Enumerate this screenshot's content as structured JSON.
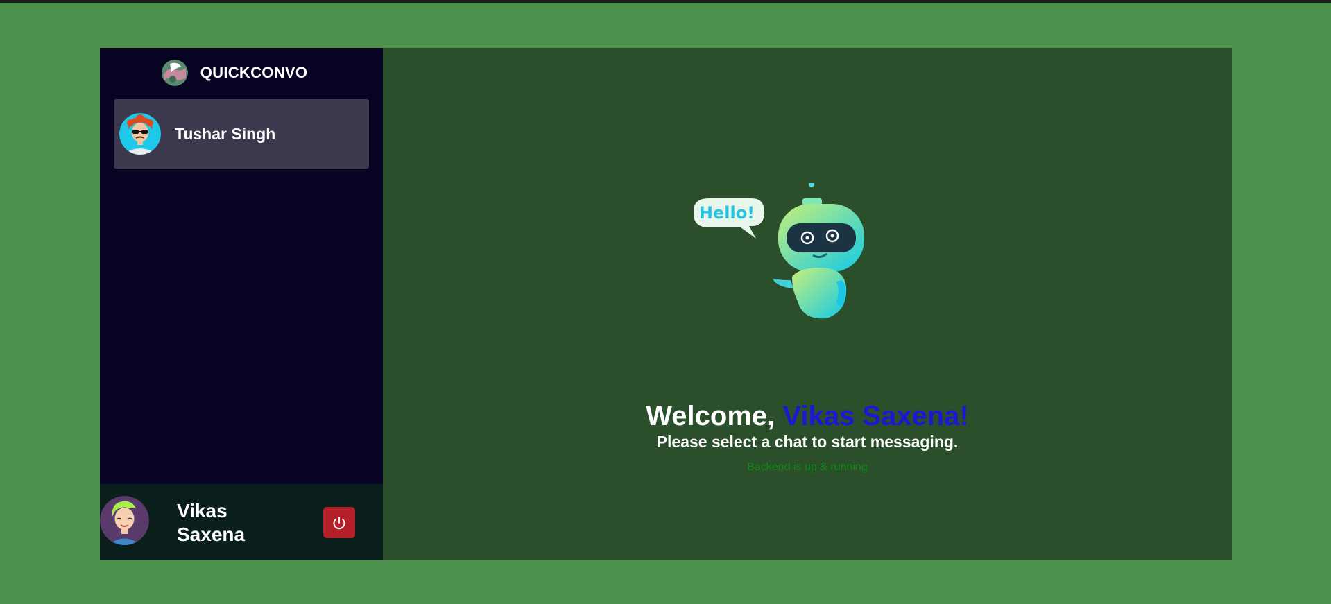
{
  "app": {
    "brand_name": "QUICKCONVO",
    "brand_icon": "app-logo-icon"
  },
  "sidebar": {
    "chats": [
      {
        "name": "Tushar Singh",
        "avatar": "avatar-icon"
      }
    ]
  },
  "current_user": {
    "name": "Vikas Saxena",
    "avatar": "avatar-icon",
    "logout_icon": "power-icon"
  },
  "main": {
    "welcome_prefix": "Welcome, ",
    "welcome_name": "Vikas Saxena!",
    "subtitle": "Please select a chat to start messaging.",
    "status": "Backend is up & running",
    "illustration_bubble_text": "Hello!"
  },
  "colors": {
    "page_background": "#4c914c",
    "sidebar_background": "#070322",
    "selected_chat_background": "#3c384e",
    "user_bar_background": "#0a1f1b",
    "main_background": "#2a4f2a",
    "welcome_name_color": "#1b17d4",
    "status_color": "#0f8a12",
    "logout_button_color": "#b51f28"
  }
}
